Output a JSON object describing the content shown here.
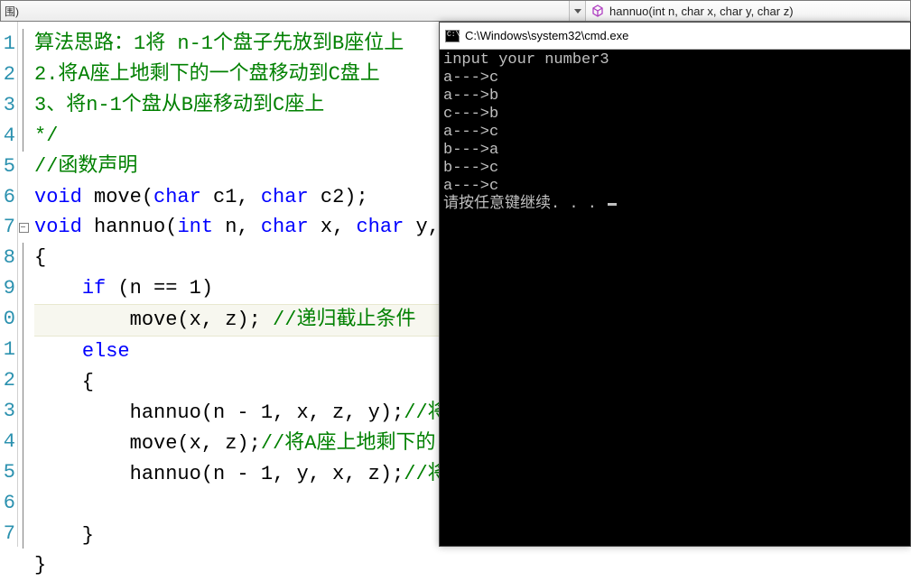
{
  "topbar": {
    "scope_label": "围)",
    "function_sig": "hannuo(int n, char x, char y, char z)"
  },
  "gutter": [
    "1",
    "2",
    "3",
    "4",
    "5",
    "6",
    "7",
    "8",
    "9",
    "0",
    "1",
    "2",
    "3",
    "4",
    "5",
    "6",
    "7"
  ],
  "code": {
    "l1": "算法思路：1将 n-1个盘子先放到B座位上",
    "l2": "2.将A座上地剩下的一个盘移动到C盘上",
    "l3": "3、将n-1个盘从B座移动到C座上",
    "l4": "*/",
    "l5": "//函数声明",
    "l6_kw1": "void",
    "l6_txt1": " move(",
    "l6_kw2": "char",
    "l6_txt2": " c1, ",
    "l6_kw3": "char",
    "l6_txt3": " c2);",
    "l7_kw1": "void",
    "l7_txt1": " hannuo(",
    "l7_kw2": "int",
    "l7_txt2": " n, ",
    "l7_kw3": "char",
    "l7_txt3": " x, ",
    "l7_kw4": "char",
    "l7_txt4": " y,",
    "l8": "{",
    "l9_kw": "if",
    "l9_txt": " (n == 1)",
    "l10_txt": "        move(x, z); ",
    "l10_cmt": "//递归截止条件",
    "l11_kw": "else",
    "l12": "    {",
    "l13_txt": "        hannuo(n - 1, x, z, y);",
    "l13_cmt": "//将",
    "l14_txt": "        move(x, z);",
    "l14_cmt": "//将A座上地剩下的",
    "l15_txt": "        hannuo(n - 1, y, x, z);",
    "l15_cmt": "//将",
    "l16": "",
    "l17": "    }",
    "l18": "}"
  },
  "console": {
    "title": "C:\\Windows\\system32\\cmd.exe",
    "lines": [
      "input your number3",
      "a--->c",
      "a--->b",
      "c--->b",
      "a--->c",
      "b--->a",
      "b--->c",
      "a--->c",
      "请按任意键继续. . . "
    ]
  }
}
